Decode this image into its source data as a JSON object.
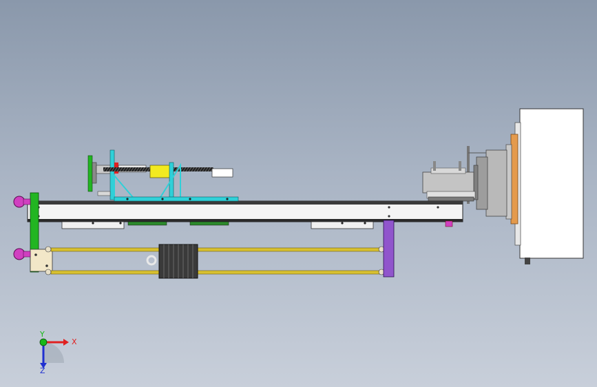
{
  "viewport": {
    "background_top": "#8a98ab",
    "background_bottom": "#c8cfda"
  },
  "triad": {
    "x_label": "X",
    "y_label": "Y",
    "z_label": "Z",
    "x_color": "#e02020",
    "y_color": "#18b818",
    "z_color": "#2030d0"
  },
  "model": {
    "parts": [
      "main-rail-beam",
      "left-end-plate",
      "right-support-post",
      "guide-rod-upper",
      "guide-rod-lower",
      "weight-stack",
      "slider-bracket",
      "lead-screw",
      "tailstock-assembly",
      "headstock-housing",
      "caster-wheel-upper",
      "caster-wheel-lower"
    ],
    "colors": {
      "beam": "#f2f2f2",
      "green_plate": "#22b522",
      "purple_post": "#9055cc",
      "magenta_wheel": "#d040c0",
      "cyan_bracket": "#30d0d8",
      "yellow_rod": "#d8c030",
      "weight": "#3a3a3a",
      "orange_flange": "#d08a40",
      "housing": "#ffffff"
    }
  }
}
